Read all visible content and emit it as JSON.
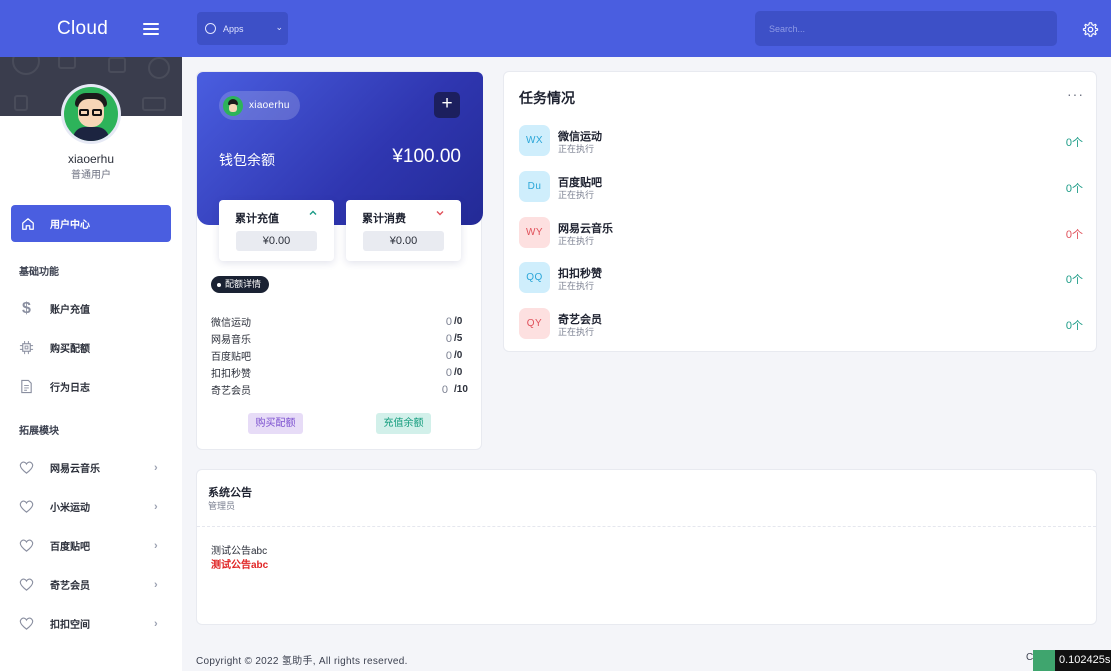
{
  "brand": {
    "name": "Cloud"
  },
  "profile": {
    "username": "xiaoerhu",
    "role": "普通用户"
  },
  "sidebar": {
    "active_item": {
      "label": "用户中心"
    },
    "sections": [
      {
        "title": "基础功能",
        "items": [
          {
            "label": "账户充值"
          },
          {
            "label": "购买配额"
          },
          {
            "label": "行为日志"
          }
        ]
      },
      {
        "title": "拓展模块",
        "items": [
          {
            "label": "网易云音乐"
          },
          {
            "label": "小米运动"
          },
          {
            "label": "百度贴吧"
          },
          {
            "label": "奇艺会员"
          },
          {
            "label": "扣扣空间"
          }
        ]
      }
    ]
  },
  "topbar": {
    "apps_label": "Apps",
    "search_placeholder": "Search..."
  },
  "wallet": {
    "username": "xiaoerhu",
    "balance_label": "钱包余额",
    "balance_value": "¥100.00",
    "total_recharge_label": "累计充值",
    "total_recharge_value": "¥0.00",
    "total_spend_label": "累计消费",
    "total_spend_value": "¥0.00",
    "detail_label": "配额详情",
    "quotas": [
      {
        "name": "微信运动",
        "used": "0",
        "total": "/0"
      },
      {
        "name": "网易音乐",
        "used": "0",
        "total": "/5"
      },
      {
        "name": "百度贴吧",
        "used": "0",
        "total": "/0"
      },
      {
        "name": "扣扣秒赞",
        "used": "0",
        "total": "/0"
      },
      {
        "name": "奇艺会员",
        "used": "0",
        "total": "/10"
      }
    ],
    "buy_label": "购买配额",
    "recharge_label": "充值余额"
  },
  "tasks": {
    "title": "任务情况",
    "more": "···",
    "items": [
      {
        "code": "WX",
        "name": "微信运动",
        "status": "正在执行",
        "count": "0个",
        "icon_bg": "#cfeefc",
        "icon_color": "#2aa6d8",
        "count_color": "#1a9b86"
      },
      {
        "code": "Du",
        "name": "百度贴吧",
        "status": "正在执行",
        "count": "0个",
        "icon_bg": "#cfeefc",
        "icon_color": "#2aa6d8",
        "count_color": "#1a9b86"
      },
      {
        "code": "WY",
        "name": "网易云音乐",
        "status": "正在执行",
        "count": "0个",
        "icon_bg": "#fde0e0",
        "icon_color": "#e0505a",
        "count_color": "#e0505a"
      },
      {
        "code": "QQ",
        "name": "扣扣秒赞",
        "status": "正在执行",
        "count": "0个",
        "icon_bg": "#cfeefc",
        "icon_color": "#2aa6d8",
        "count_color": "#1a9b86"
      },
      {
        "code": "QY",
        "name": "奇艺会员",
        "status": "正在执行",
        "count": "0个",
        "icon_bg": "#fde0e0",
        "icon_color": "#e0505a",
        "count_color": "#1a9b86"
      }
    ]
  },
  "notice": {
    "title": "系统公告",
    "subtitle": "管理员",
    "line1": "测试公告abc",
    "line2": "测试公告abc"
  },
  "footer": {
    "copyright": "Copyright © 2022 氢助手, All rights reserved.",
    "right_fragment": "C",
    "timer": "0.102425s"
  }
}
